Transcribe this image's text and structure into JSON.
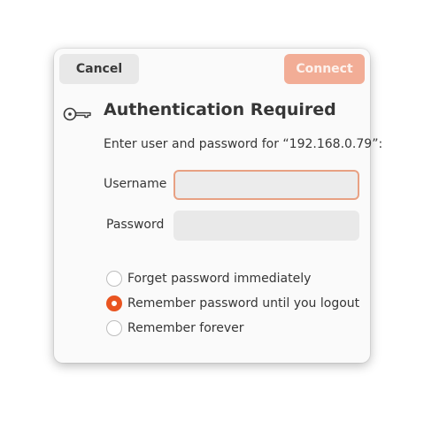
{
  "dialog": {
    "cancel_label": "Cancel",
    "connect_label": "Connect",
    "title": "Authentication Required",
    "prompt": "Enter user and password for “192.168.0.79”:",
    "icon": "key-icon",
    "accent_color": "#e95420"
  },
  "form": {
    "username_label": "Username",
    "username_value": "",
    "password_label": "Password",
    "password_value": ""
  },
  "remember": {
    "options": [
      {
        "label": "Forget password immediately",
        "selected": false
      },
      {
        "label": "Remember password until you logout",
        "selected": true
      },
      {
        "label": "Remember forever",
        "selected": false
      }
    ]
  }
}
